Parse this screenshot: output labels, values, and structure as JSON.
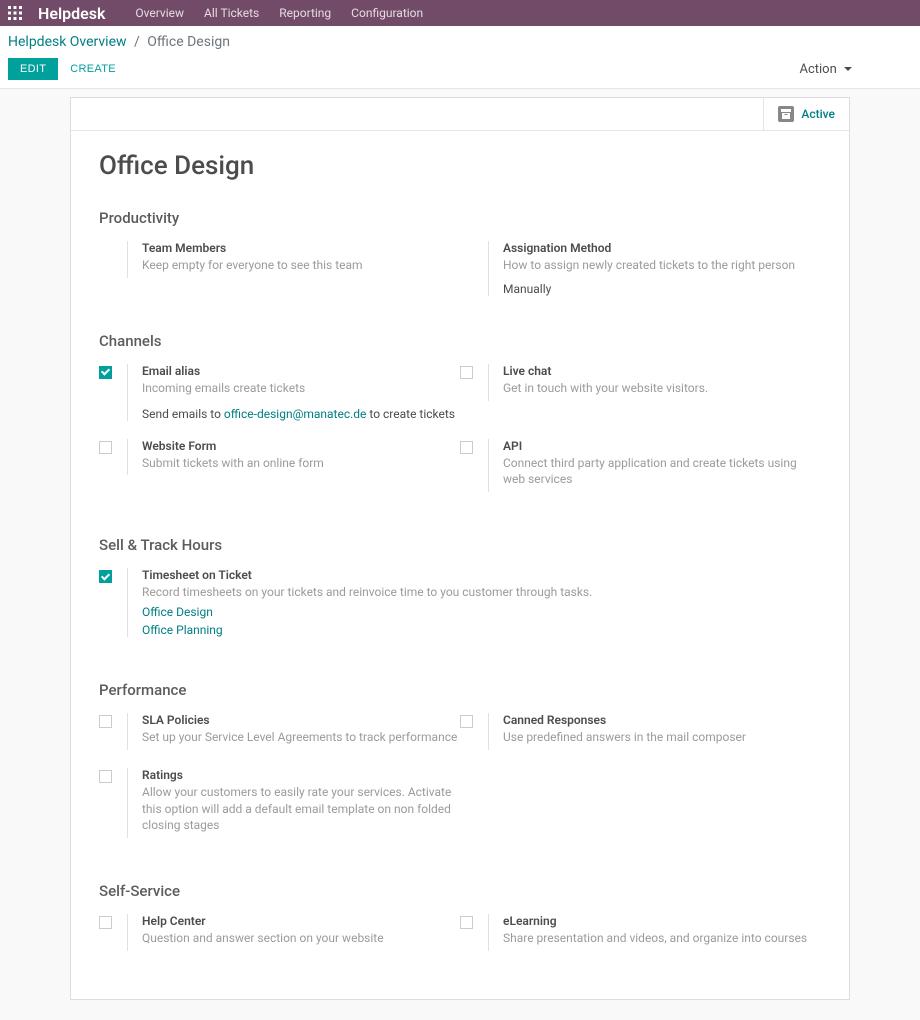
{
  "nav": {
    "app_title": "Helpdesk",
    "items": [
      "Overview",
      "All Tickets",
      "Reporting",
      "Configuration"
    ]
  },
  "breadcrumb": {
    "parent": "Helpdesk Overview",
    "current": "Office Design"
  },
  "buttons": {
    "edit": "EDIT",
    "create": "CREATE",
    "action": "Action"
  },
  "status": {
    "active": "Active"
  },
  "title": "Office Design",
  "sections": {
    "productivity": {
      "title": "Productivity",
      "team_members": {
        "label": "Team Members",
        "help": "Keep empty for everyone to see this team"
      },
      "assignation": {
        "label": "Assignation Method",
        "help": "How to assign newly created tickets to the right person",
        "value": "Manually"
      }
    },
    "channels": {
      "title": "Channels",
      "email": {
        "label": "Email alias",
        "help": "Incoming emails create tickets",
        "line_prefix": "Send emails to ",
        "email": "office-design@manatec.de",
        "line_suffix": " to create tickets"
      },
      "livechat": {
        "label": "Live chat",
        "help": "Get in touch with your website visitors."
      },
      "website": {
        "label": "Website Form",
        "help": "Submit tickets with an online form"
      },
      "api": {
        "label": "API",
        "help": "Connect third party application and create tickets using web services"
      }
    },
    "sell": {
      "title": "Sell & Track Hours",
      "timesheet": {
        "label": "Timesheet on Ticket",
        "help": "Record timesheets on your tickets and reinvoice time to you customer through tasks.",
        "links": [
          "Office Design",
          "Office Planning"
        ]
      }
    },
    "performance": {
      "title": "Performance",
      "sla": {
        "label": "SLA Policies",
        "help": "Set up your Service Level Agreements to track performance"
      },
      "canned": {
        "label": "Canned Responses",
        "help": "Use predefined answers in the mail composer"
      },
      "ratings": {
        "label": "Ratings",
        "help": "Allow your customers to easily rate your services. Activate this option will add a default email template on non folded closing stages"
      }
    },
    "self_service": {
      "title": "Self-Service",
      "help_center": {
        "label": "Help Center",
        "help": "Question and answer section on your website"
      },
      "elearning": {
        "label": "eLearning",
        "help": "Share presentation and videos, and organize into courses"
      }
    }
  }
}
